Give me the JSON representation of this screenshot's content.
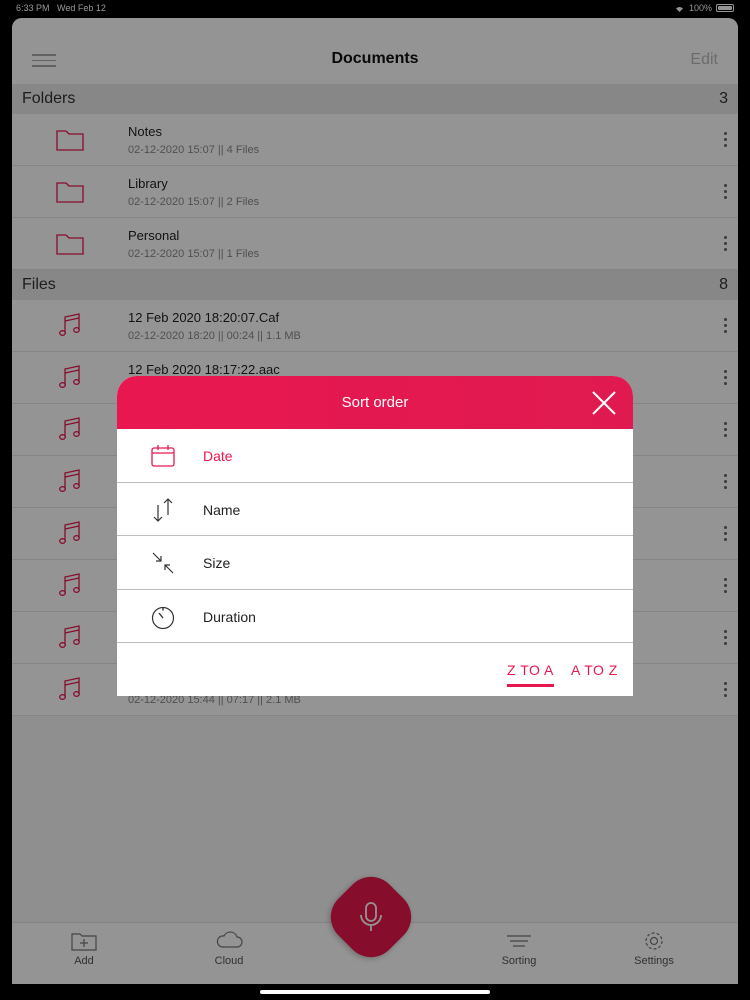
{
  "status": {
    "time": "6:33 PM",
    "date": "Wed Feb 12",
    "battery": "100%"
  },
  "nav": {
    "title": "Documents",
    "edit": "Edit"
  },
  "folders": {
    "label": "Folders",
    "count": "3",
    "items": [
      {
        "name": "Notes",
        "meta": "02-12-2020 15:07 || 4 Files"
      },
      {
        "name": "Library",
        "meta": "02-12-2020 15:07 || 2 Files"
      },
      {
        "name": "Personal",
        "meta": "02-12-2020 15:07 || 1 Files"
      }
    ]
  },
  "files": {
    "label": "Files",
    "count": "8",
    "items": [
      {
        "name": "12 Feb 2020 18:20:07.Caf",
        "meta": "02-12-2020 18:20 || 00:24 || 1.1 MB"
      },
      {
        "name": "12 Feb 2020 18:17:22.aac",
        "meta": ""
      },
      {
        "name": "",
        "meta": ""
      },
      {
        "name": "",
        "meta": ""
      },
      {
        "name": "",
        "meta": ""
      },
      {
        "name": "",
        "meta": ""
      },
      {
        "name": "",
        "meta": ""
      },
      {
        "name": "",
        "meta": "02-12-2020 15:44 || 07:17 || 2.1 MB"
      }
    ]
  },
  "tabs": {
    "add": "Add",
    "cloud": "Cloud",
    "sorting": "Sorting",
    "settings": "Settings"
  },
  "sort": {
    "title": "Sort order",
    "options": [
      "Date",
      "Name",
      "Size",
      "Duration"
    ],
    "selected": "Date",
    "z_to_a": "Z TO A",
    "a_to_z": "A TO Z",
    "order_selected": "Z TO A"
  },
  "colors": {
    "accent": "#e8174f"
  }
}
